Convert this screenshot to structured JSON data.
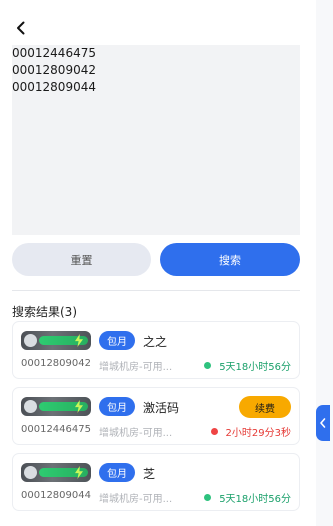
{
  "header": {
    "back_icon": "chevron-left-icon"
  },
  "search": {
    "lines": [
      "00012446475",
      "00012809042",
      "00012809044"
    ]
  },
  "buttons": {
    "reset_label": "重置",
    "search_label": "搜索"
  },
  "results": {
    "title": "搜索结果(3)",
    "items": [
      {
        "badge": "包月",
        "name": "之之",
        "code": "00012809042",
        "location": "增城机房-可用...",
        "status": "5天18小时56分",
        "status_color": "#1aa06a",
        "dot_color": "#2ec27e",
        "renew_label": ""
      },
      {
        "badge": "包月",
        "name": "激活码",
        "code": "00012446475",
        "location": "增城机房-可用...",
        "status": "2小时29分3秒",
        "status_color": "#e53935",
        "dot_color": "#ef4444",
        "renew_label": "续费"
      },
      {
        "badge": "包月",
        "name": "芝",
        "code": "00012809044",
        "location": "增城机房-可用...",
        "status": "5天18小时56分",
        "status_color": "#1aa06a",
        "dot_color": "#2ec27e",
        "renew_label": ""
      }
    ]
  },
  "side_tab": {
    "icon": "chevron-left-icon"
  },
  "colors": {
    "primary": "#2f6fed",
    "renew": "#f8a900"
  }
}
